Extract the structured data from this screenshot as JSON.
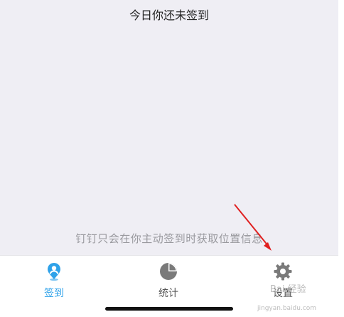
{
  "main": {
    "status_text": "今日你还未签到",
    "privacy_text": "钉钉只会在你主动签到时获取位置信息"
  },
  "tabbar": {
    "tabs": [
      {
        "label": "签到",
        "icon": "location-pin-icon",
        "active": true
      },
      {
        "label": "统计",
        "icon": "pie-chart-icon",
        "active": false
      },
      {
        "label": "设置",
        "icon": "gear-icon",
        "active": false
      }
    ]
  },
  "colors": {
    "accent": "#2fa2e9",
    "background": "#efeef4",
    "annotation_arrow": "#e02020"
  },
  "watermark": {
    "text": "Bai 经验",
    "sub": "jingyan.baidu.com"
  }
}
